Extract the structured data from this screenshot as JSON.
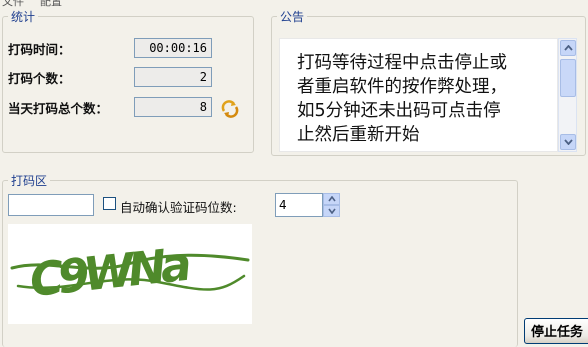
{
  "menubar": {
    "items": [
      "文件",
      "配置"
    ]
  },
  "stats": {
    "title": "统计",
    "time_label": "打码时间：",
    "time_value": "00:00:16",
    "count_label": "打码个数：",
    "count_value": "2",
    "total_label": "当天打码总个数：",
    "total_value": "8",
    "refresh_icon": "refresh-icon"
  },
  "notice": {
    "title": "公告",
    "lines": [
      "打码等待过程中点击停止或",
      "者重启软件的按作弊处理，",
      "如5分钟还未出码可点击停",
      "止然后重新开始"
    ]
  },
  "work": {
    "title": "打码区",
    "input_value": "",
    "auto_confirm_label": "自动确认验证码位数:",
    "auto_confirm_checked": false,
    "digits_value": "4",
    "captcha_text": "C9WNa",
    "captcha_color": "#4f8a2b"
  },
  "stop_button": {
    "label": "停止任务"
  }
}
